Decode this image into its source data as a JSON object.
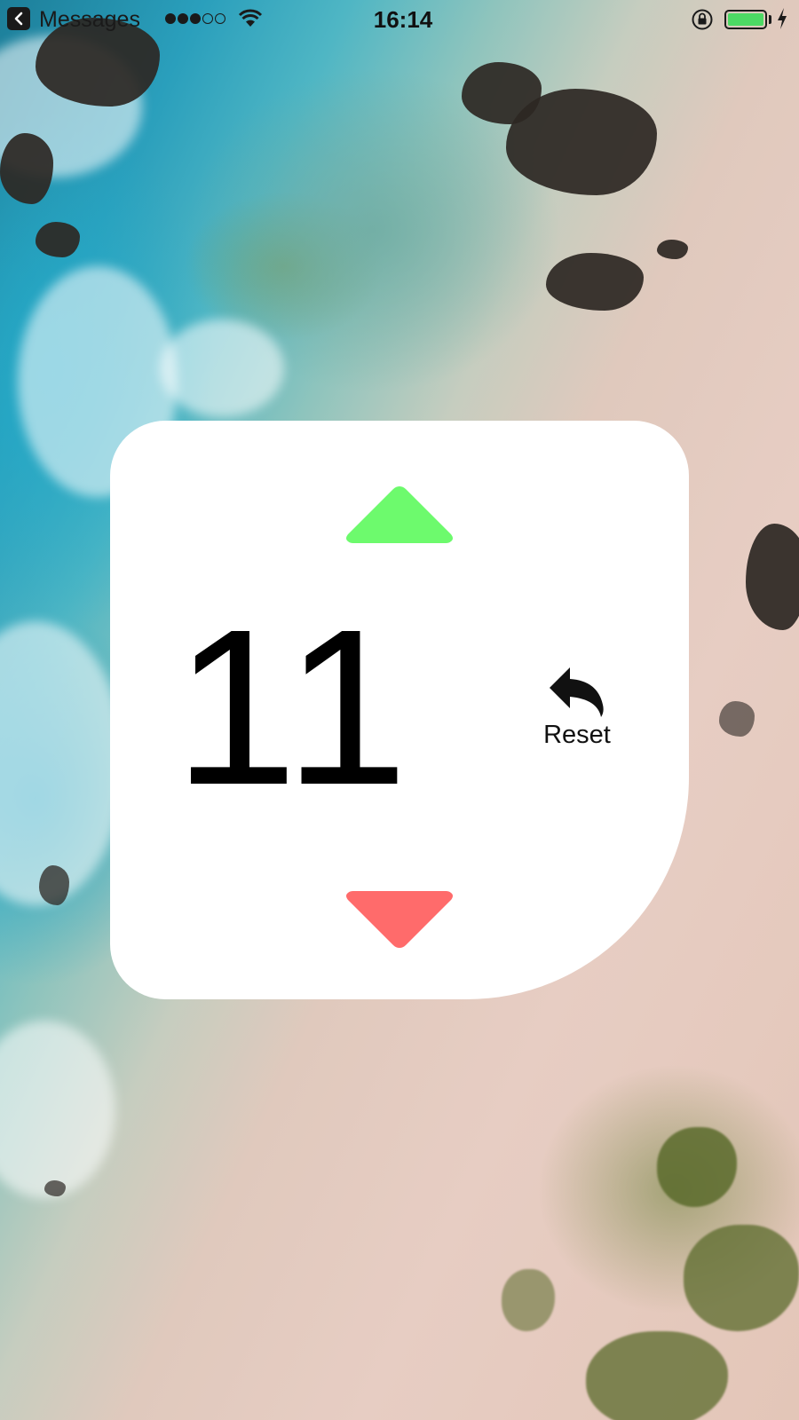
{
  "status_bar": {
    "back_label": "Messages",
    "signal_dots_filled": 3,
    "signal_dots_total": 5,
    "time": "16:14",
    "battery_level": 1.0,
    "battery_color": "#4cd964",
    "icons": [
      "back-arrow-icon",
      "wifi-icon",
      "orientation-lock-icon",
      "battery-icon",
      "charging-bolt-icon"
    ]
  },
  "counter": {
    "value": "11",
    "increment_icon": "triangle-up-icon",
    "decrement_icon": "triangle-down-icon",
    "increment_color": "#6dfa6d",
    "decrement_color": "#ff6b6b",
    "reset_label": "Reset",
    "reset_icon": "undo-arrow-icon"
  }
}
